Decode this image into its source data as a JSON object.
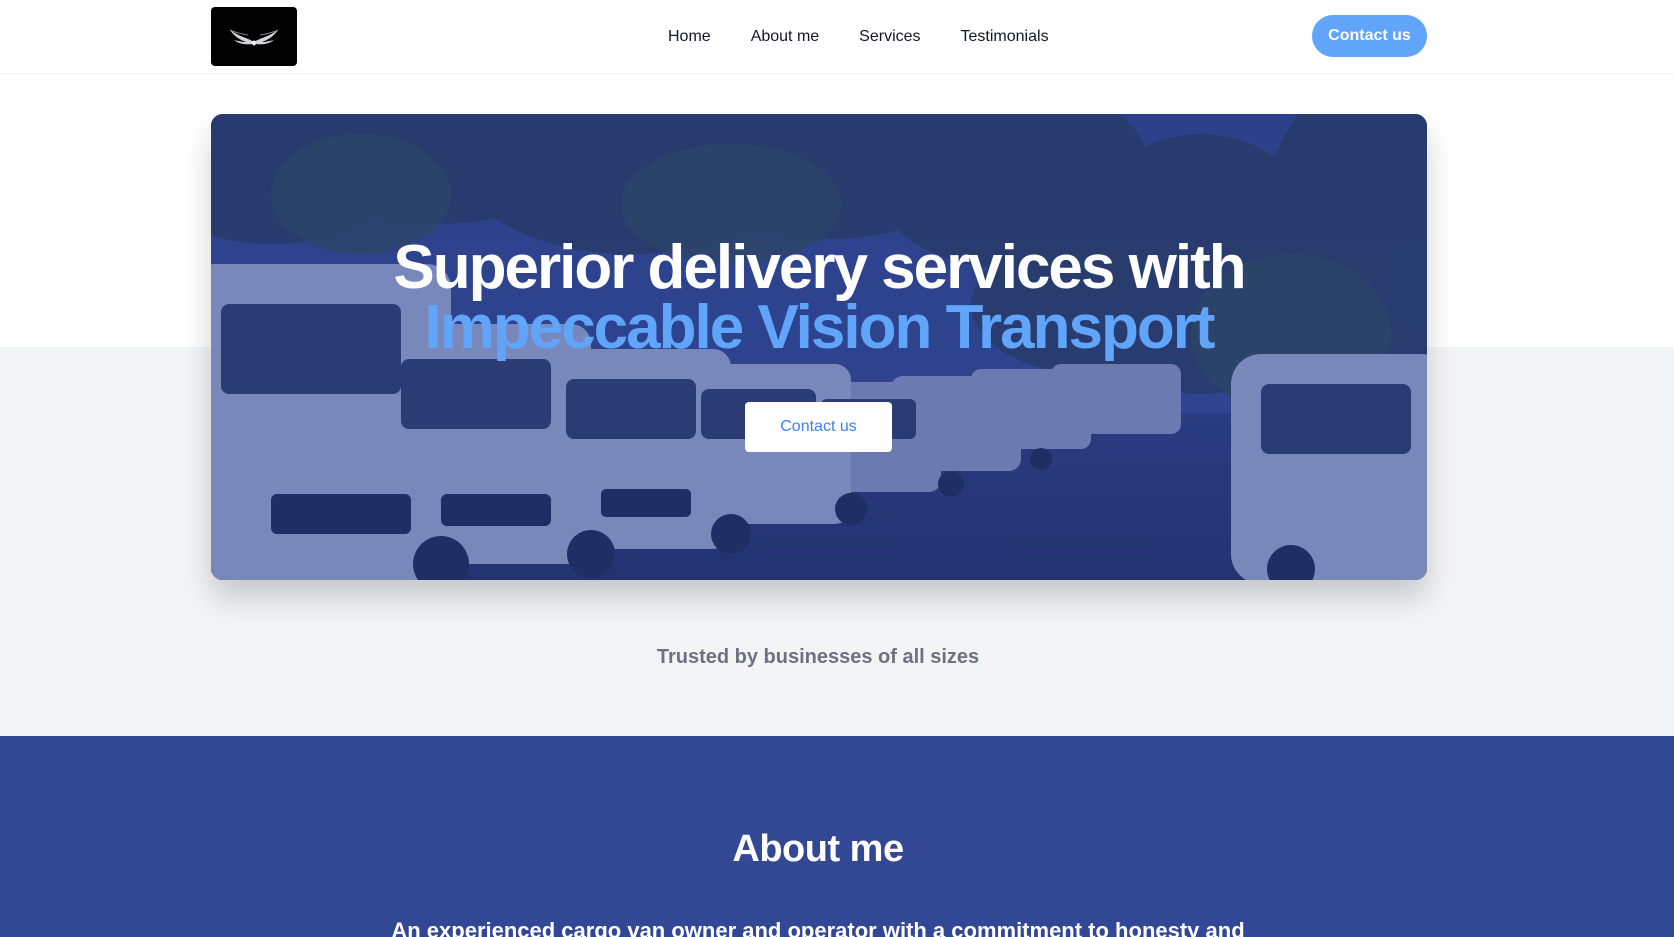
{
  "header": {
    "logo_alt": "winged logo",
    "nav": [
      {
        "label": "Home"
      },
      {
        "label": "About me"
      },
      {
        "label": "Services"
      },
      {
        "label": "Testimonials"
      }
    ],
    "cta_label": "Contact us"
  },
  "hero": {
    "title_line1": "Superior delivery services with",
    "title_line2": "Impeccable Vision Transport",
    "cta_label": "Contact us"
  },
  "trusted": {
    "text": "Trusted by businesses of all sizes"
  },
  "about": {
    "title": "About me",
    "intro": "An experienced cargo van owner and operator with a commitment to honesty and"
  },
  "colors": {
    "accent": "#60a5fa",
    "brand_blue": "#334894",
    "hero_overlay": "#2c3f86",
    "muted_text": "#6b7280"
  },
  "icons": {
    "logo": "wings-icon"
  }
}
